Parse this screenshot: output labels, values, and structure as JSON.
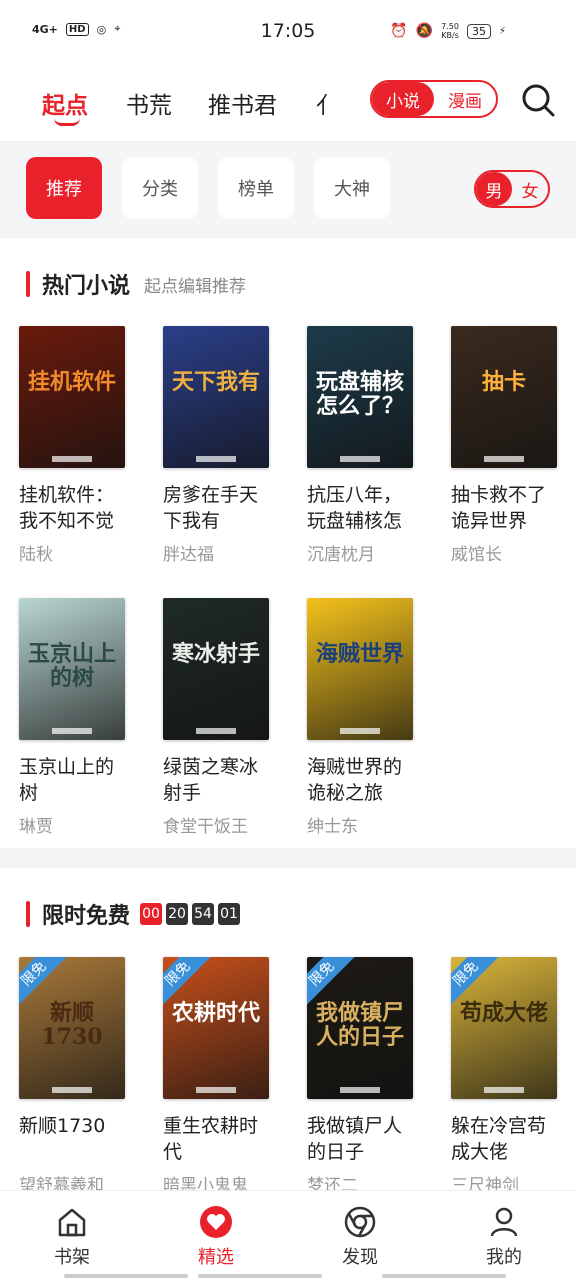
{
  "status": {
    "network": "4G+",
    "hd": "HD",
    "time": "17:05",
    "speed_value": "7.50",
    "speed_unit": "KB/s",
    "battery": "35"
  },
  "topnav": {
    "tabs": [
      "起点",
      "书荒",
      "推书君",
      "(更多)"
    ],
    "mode": [
      "小说",
      "漫画"
    ]
  },
  "filters": {
    "chips": [
      "推荐",
      "分类",
      "榜单",
      "大神"
    ],
    "gender": [
      "男",
      "女"
    ]
  },
  "hot": {
    "title": "热门小说",
    "subtitle": "起点编辑推荐",
    "books": [
      {
        "name": "挂机软件：我不知不觉",
        "author": "陆秋",
        "cover_title": "挂机软件",
        "cover_color": "#6a1a0c",
        "accent": "#f08a2a"
      },
      {
        "name": "房爹在手天下我有",
        "author": "胖达福",
        "cover_title": "天下我有",
        "cover_color": "#2b3f8a",
        "accent": "#f0b040"
      },
      {
        "name": "抗压八年，玩盘辅核怎",
        "author": "沉唐枕月",
        "cover_title": "玩盘辅核怎么了？",
        "cover_color": "#1d3b4a",
        "accent": "#ffffff"
      },
      {
        "name": "抽卡救不了诡异世界",
        "author": "威馆长",
        "cover_title": "抽卡",
        "cover_color": "#3a2a1e",
        "accent": "#ffb03a"
      },
      {
        "name": "玉京山上的树",
        "author": "琳贾",
        "cover_title": "玉京山上的树",
        "cover_color": "#b9d6d2",
        "accent": "#2b4a44"
      },
      {
        "name": "绿茵之寒冰射手",
        "author": "食堂干饭王",
        "cover_title": "寒冰射手",
        "cover_color": "#1f2a26",
        "accent": "#e9efe9"
      },
      {
        "name": "海贼世界的诡秘之旅",
        "author": "绅士东",
        "cover_title": "海贼世界",
        "cover_color": "#f4c21c",
        "accent": "#1a3f7a"
      }
    ]
  },
  "free": {
    "title": "限时免费",
    "timer": [
      "00",
      "20",
      "54",
      "01"
    ],
    "badge": "限免",
    "books": [
      {
        "name": "新顺1730",
        "author": "望舒慕羲和",
        "cover_title": "新顺1730",
        "cover_color": "#a9793a",
        "accent": "#4a2a12"
      },
      {
        "name": "重生农耕时代",
        "author": "暗黑小鬼鬼",
        "cover_title": "农耕时代",
        "cover_color": "#c7501b",
        "accent": "#ffffff"
      },
      {
        "name": "我做镇尸人的日子",
        "author": "梦还二",
        "cover_title": "我做镇尸人的日子",
        "cover_color": "#1d1a14",
        "accent": "#d8b060"
      },
      {
        "name": "躲在冷宫苟成大佬",
        "author": "三尺神剑",
        "cover_title": "苟成大佬",
        "cover_color": "#d9b43a",
        "accent": "#3a2a0e"
      }
    ]
  },
  "bottomnav": {
    "items": [
      "书架",
      "精选",
      "发现",
      "我的"
    ],
    "active": "精选"
  },
  "colors": {
    "brand": "#e8212b",
    "badge_blue": "#3a8fd9"
  }
}
